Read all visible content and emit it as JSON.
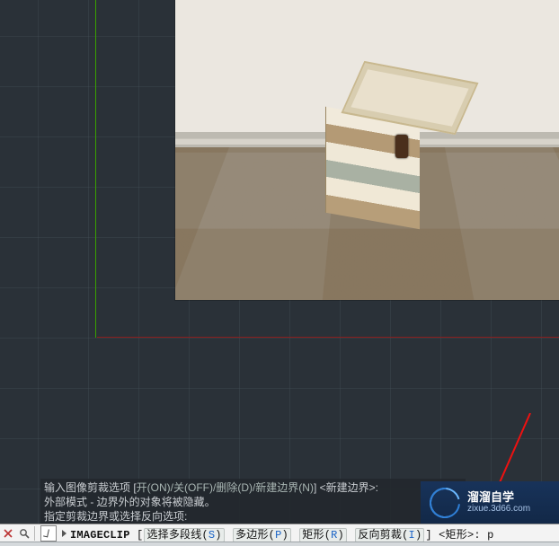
{
  "prompt": {
    "line1_prefix": "输入图像剪裁选项 [",
    "line1_options": "开(ON)/关(OFF)/删除(D)/新建边界(N)",
    "line1_suffix": "] <新建边界>:",
    "line2": "外部模式 - 边界外的对象将被隐藏。",
    "line3": "指定剪裁边界或选择反向选项:"
  },
  "command": {
    "name": "IMAGECLIP",
    "bracket_open": " [",
    "opts": {
      "select_poly": {
        "label": "选择多段线(",
        "hot": "S",
        "close": ")"
      },
      "polygon": {
        "label": "多边形(",
        "hot": "P",
        "close": ")"
      },
      "rect": {
        "label": "矩形(",
        "hot": "R",
        "close": ")"
      },
      "invert": {
        "label": "反向剪裁(",
        "hot": "I",
        "close": ")"
      }
    },
    "tail": "] <矩形>: p"
  },
  "watermark": {
    "title": "溜溜自学",
    "url": "zixue.3d66.com"
  },
  "icons": {
    "close": "close-icon",
    "zoom": "zoom-icon",
    "input": "command-input-icon",
    "chevron": "chevron-right-icon"
  }
}
